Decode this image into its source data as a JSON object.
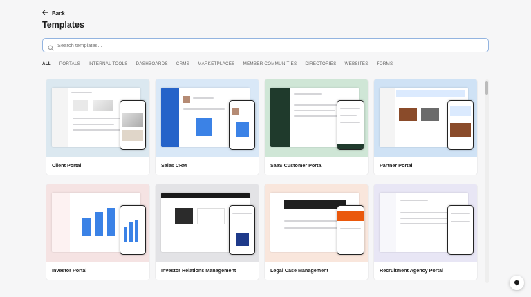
{
  "header": {
    "back_label": "Back",
    "title": "Templates"
  },
  "search": {
    "placeholder": "Search templates..."
  },
  "tabs": [
    {
      "label": "ALL",
      "active": true
    },
    {
      "label": "PORTALS"
    },
    {
      "label": "INTERNAL TOOLS"
    },
    {
      "label": "DASHBOARDS"
    },
    {
      "label": "CRMS"
    },
    {
      "label": "MARKETPLACES"
    },
    {
      "label": "MEMBER COMMUNITIES"
    },
    {
      "label": "DIRECTORIES"
    },
    {
      "label": "WEBSITES"
    },
    {
      "label": "FORMS"
    }
  ],
  "cards": [
    {
      "label": "Client Portal",
      "bg": "#dbe8f0"
    },
    {
      "label": "Sales CRM",
      "bg": "#d9e8f7"
    },
    {
      "label": "SaaS Customer Portal",
      "bg": "#cfe6d6"
    },
    {
      "label": "Partner Portal",
      "bg": "#cfe2f5"
    },
    {
      "label": "Investor Portal",
      "bg": "#f5e3e3"
    },
    {
      "label": "Investor Relations Management",
      "bg": "#e3e3e6"
    },
    {
      "label": "Legal Case Management",
      "bg": "#f9e6dc"
    },
    {
      "label": "Recruitment Agency Portal",
      "bg": "#e8e6f5"
    }
  ],
  "colors": {
    "accent": "#e8a24a",
    "search_border": "#93b4e0"
  }
}
